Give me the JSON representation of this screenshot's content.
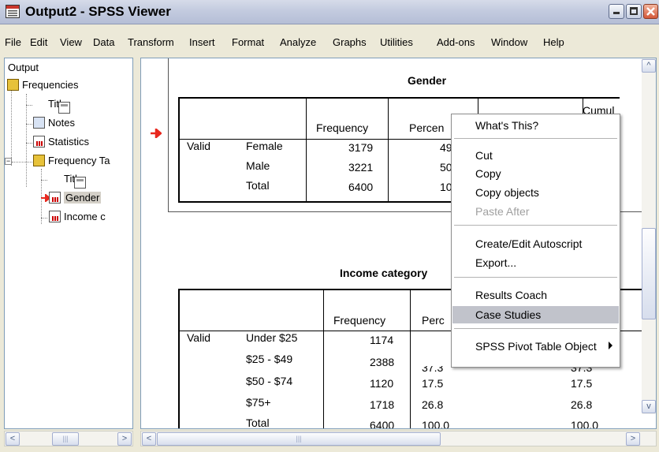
{
  "window": {
    "title": "Output2 - SPSS Viewer",
    "min_glyph": "−",
    "max_glyph": "□",
    "close_glyph": "✕"
  },
  "menubar": {
    "items": [
      "File",
      "Edit",
      "View",
      "Data",
      "Transform",
      "Insert",
      "Format",
      "Analyze",
      "Graphs",
      "Utilities",
      "Add-ons",
      "Window",
      "Help"
    ]
  },
  "tree": {
    "root": "Output",
    "frequencies": "Frequencies",
    "title1": "Title",
    "notes": "Notes",
    "statistics": "Statistics",
    "freq_tables": "Frequency Ta",
    "title2": "Title",
    "gender": "Gender",
    "income": "Income c"
  },
  "gender_table": {
    "title": "Gender",
    "headers": [
      "Frequency",
      "Percen",
      "Cumul"
    ],
    "header_cum2": "e",
    "valid_label": "Valid",
    "rows": [
      {
        "label": "Female",
        "freq": "3179",
        "pct": "49"
      },
      {
        "label": "Male",
        "freq": "3221",
        "pct": "50"
      },
      {
        "label": "Total",
        "freq": "6400",
        "pct": "100"
      }
    ]
  },
  "income_table": {
    "title": "Income category",
    "headers": [
      "Frequency",
      "Perc"
    ],
    "valid_label": "Valid",
    "rows": [
      {
        "label": "Under $25",
        "freq": "1174",
        "pct": "",
        "vpct": ""
      },
      {
        "label": "$25 - $49",
        "freq": "2388",
        "pct": "37.3",
        "vpct": "37.3"
      },
      {
        "label": "$50 - $74",
        "freq": "1120",
        "pct": "17.5",
        "vpct": "17.5"
      },
      {
        "label": "$75+",
        "freq": "1718",
        "pct": "26.8",
        "vpct": "26.8"
      },
      {
        "label": "Total",
        "freq": "6400",
        "pct": "100.0",
        "vpct": "100.0"
      }
    ]
  },
  "context_menu": {
    "items": [
      {
        "label": "What's This?"
      },
      {
        "label": "Cut"
      },
      {
        "label": "Copy"
      },
      {
        "label": "Copy objects"
      },
      {
        "label": "Paste After",
        "disabled": true
      },
      {
        "label": "Create/Edit Autoscript"
      },
      {
        "label": "Export..."
      },
      {
        "label": "Results Coach"
      },
      {
        "label": "Case Studies",
        "highlighted": true
      },
      {
        "label": "SPSS Pivot Table Object"
      }
    ]
  },
  "scroll": {
    "left_arrow": "<",
    "right_arrow": ">",
    "up_arrow": "^",
    "down_arrow": "v",
    "grip": "|||"
  },
  "colors": {
    "accent_red": "#e8281e",
    "menu_highlight": "#c1c3cb"
  }
}
